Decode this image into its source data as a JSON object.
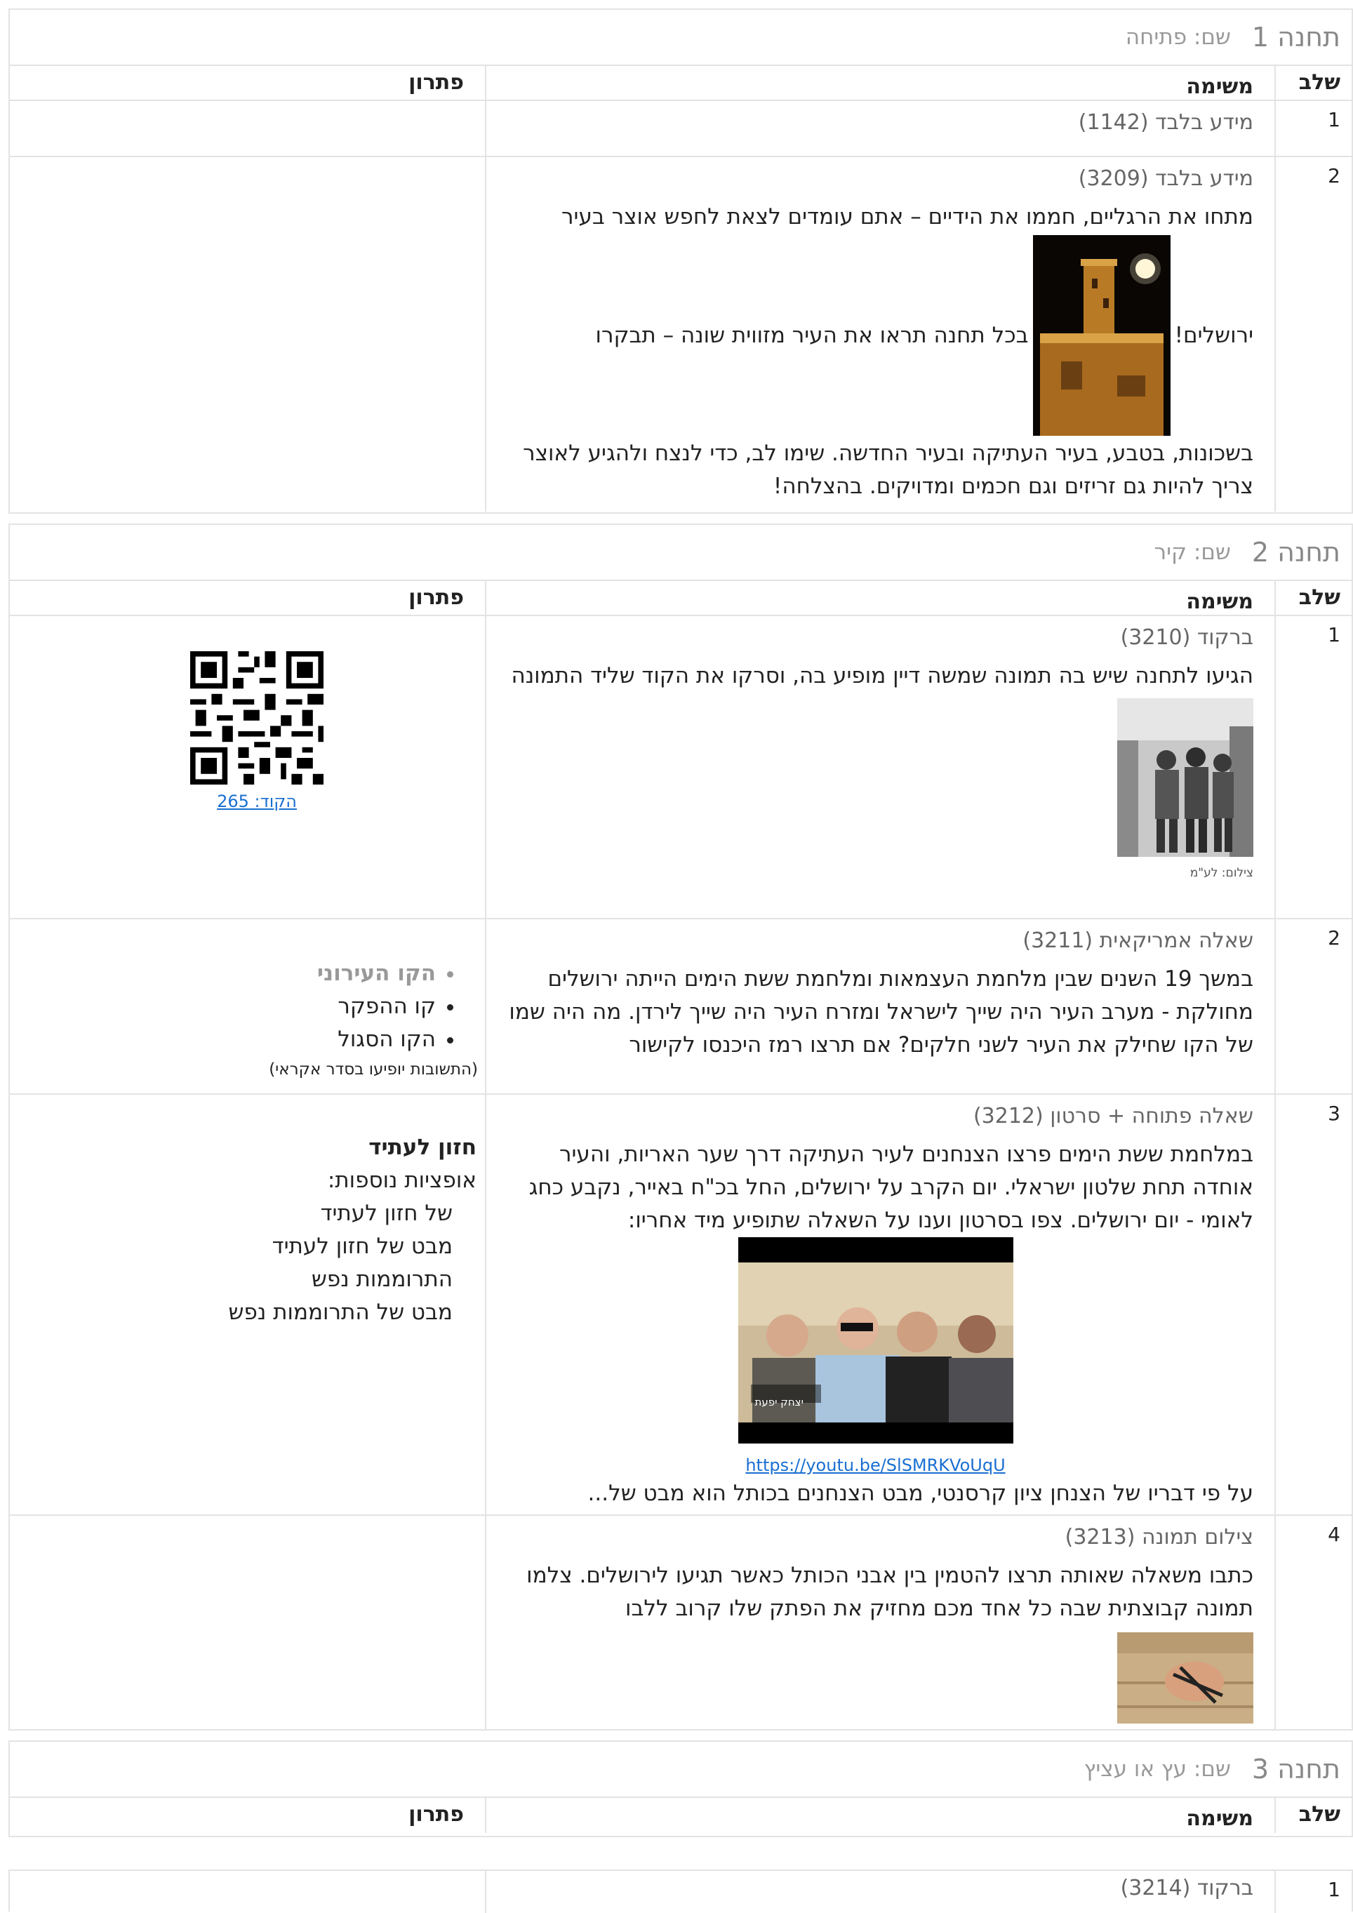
{
  "station1": {
    "title": "תחנה 1",
    "name": "שם: פתיחה",
    "headers": {
      "step": "שלב",
      "task": "משימה",
      "solution": "פתרון"
    },
    "rows": [
      {
        "step": "1",
        "type": "מידע בלבד (1142)"
      },
      {
        "step": "2",
        "type": "מידע בלבד (3209)",
        "text1": "מתחו את הרגליים, חממו את הידיים – אתם עומדים לצאת לחפש אוצר בעיר",
        "text2a": "ירושלים!",
        "text2b": "בכל תחנה תראו את העיר מזווית שונה – תבקרו",
        "text3": "בשכונות, בטבע, בעיר העתיקה ובעיר החדשה. שימו לב, כדי לנצח ולהגיע לאוצר צריך להיות גם זריזים וגם חכמים ומדויקים. בהצלחה!"
      }
    ]
  },
  "station2": {
    "title": "תחנה 2",
    "name": "שם: קיר",
    "headers": {
      "step": "שלב",
      "task": "משימה",
      "solution": "פתרון"
    },
    "rows": [
      {
        "step": "1",
        "type": "ברקוד (3210)",
        "text": "הגיעו לתחנה שיש בה תמונה שמשה דיין מופיע בה, וסרקו את הקוד שליד התמונה",
        "caption": "צילום: לע\"מ",
        "solution_code": "הקוד: 265"
      },
      {
        "step": "2",
        "type": "שאלה אמריקאית (3211)",
        "text": "במשך 19 השנים שבין מלחמת העצמאות ומלחמת ששת הימים הייתה ירושלים מחולקת - מערב העיר היה שייך לישראל ומזרח העיר היה שייך לירדן. מה היה שמו של הקו שחילק את העיר לשני חלקים? אם תרצו רמז היכנסו לקישור",
        "options": [
          "הקו העירוני",
          "קו ההפקר",
          "הקו הסגול"
        ],
        "options_note": "(התשובות יופיעו בסדר אקראי)"
      },
      {
        "step": "3",
        "type": "שאלה פתוחה + סרטון (3212)",
        "text": "במלחמת ששת הימים פרצו הצנחנים לעיר העתיקה דרך שער האריות, והעיר אוחדה תחת שלטון ישראלי. יום הקרב על ירושלים, החל בכ\"ח באייר, נקבע כחג לאומי - יום ירושלים. צפו בסרטון וענו על השאלה שתופיע מיד אחריו:",
        "video_caption": "יצחק יפעת",
        "link": "https://youtu.be/SlSMRKVoUqU",
        "text_after": "על פי דבריו של הצנחן ציון קרסנטי, מבט הצנחנים בכותל הוא מבט של...",
        "answer_title": "חזון לעתיד",
        "answer_sub": "אופציות נוספות:",
        "answer_options": [
          "של חזון לעתיד",
          "מבט של חזון לעתיד",
          "התרוממות נפש",
          "מבט של התרוממות נפש"
        ]
      },
      {
        "step": "4",
        "type": "צילום תמונה (3213)",
        "text": "כתבו משאלה שאותה תרצו להטמין בין אבני הכותל כאשר תגיעו לירושלים. צלמו תמונה קבוצתית שבה כל אחד מכם מחזיק את הפתק שלו קרוב ללבו"
      }
    ]
  },
  "station3": {
    "title": "תחנה 3",
    "name": "שם: עץ או עציץ",
    "headers": {
      "step": "שלב",
      "task": "משימה",
      "solution": "פתרון"
    },
    "rows": [
      {
        "step": "1",
        "type": "ברקוד (3214)"
      }
    ]
  }
}
